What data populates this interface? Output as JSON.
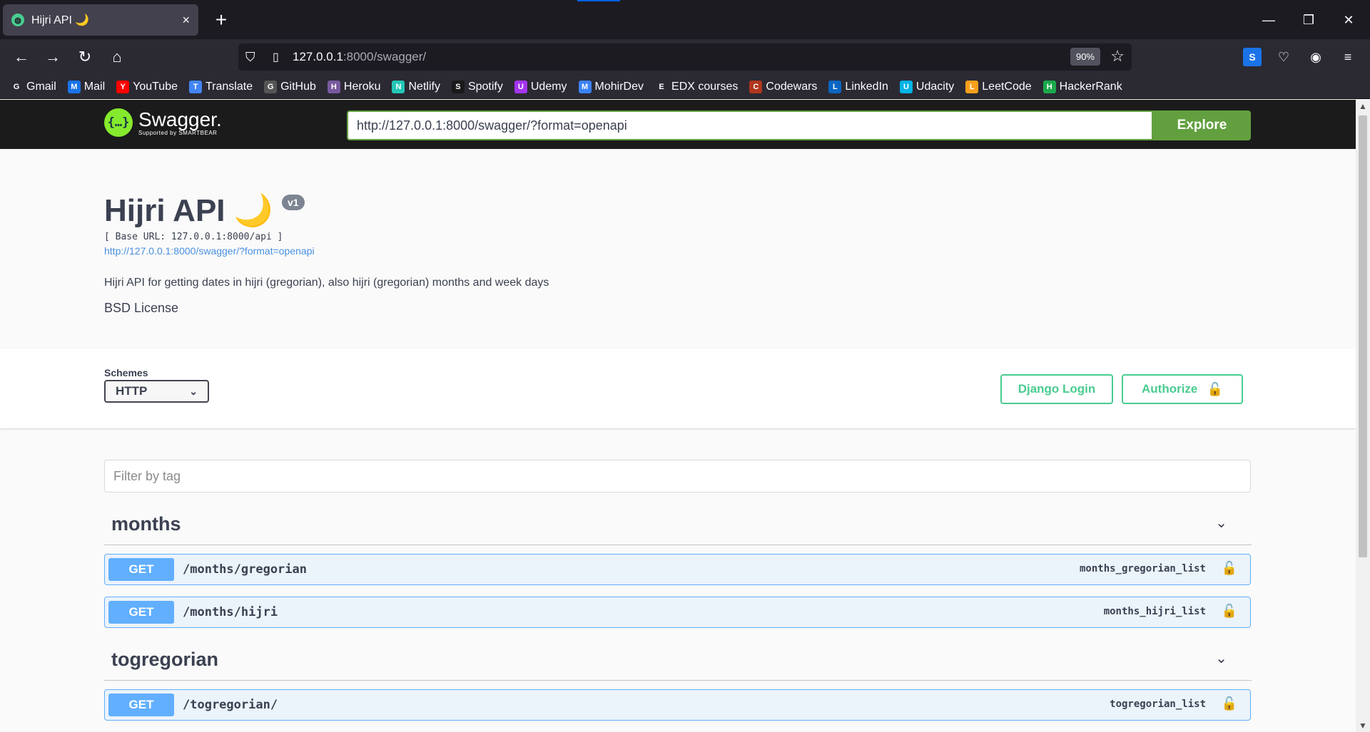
{
  "browser": {
    "tab_title": "Hijri API 🌙",
    "tab_close": "×",
    "new_tab": "+",
    "url_host": "127.0.0.1",
    "url_rest": ":8000/swagger/",
    "zoom": "90%",
    "window_controls": [
      "—",
      "❐",
      "✕"
    ],
    "bookmarks": [
      {
        "label": "Gmail",
        "icon": "globe-icon",
        "color": "#2b2a33"
      },
      {
        "label": "Mail",
        "icon": "mail-icon",
        "color": "#1a73e8"
      },
      {
        "label": "YouTube",
        "icon": "youtube-icon",
        "color": "#ff0000"
      },
      {
        "label": "Translate",
        "icon": "translate-icon",
        "color": "#4285f4"
      },
      {
        "label": "GitHub",
        "icon": "github-icon",
        "color": "#555555"
      },
      {
        "label": "Heroku",
        "icon": "heroku-icon",
        "color": "#79589f"
      },
      {
        "label": "Netlify",
        "icon": "netlify-icon",
        "color": "#25c7b7"
      },
      {
        "label": "Spotify",
        "icon": "spotify-icon",
        "color": "#1a1a1a"
      },
      {
        "label": "Udemy",
        "icon": "udemy-icon",
        "color": "#a435f0"
      },
      {
        "label": "MohirDev",
        "icon": "mohirdev-icon",
        "color": "#3b82f6"
      },
      {
        "label": "EDX courses",
        "icon": "edx-icon",
        "color": "#2b2a33"
      },
      {
        "label": "Codewars",
        "icon": "codewars-icon",
        "color": "#b1361e"
      },
      {
        "label": "LinkedIn",
        "icon": "linkedin-icon",
        "color": "#0a66c2"
      },
      {
        "label": "Udacity",
        "icon": "udacity-icon",
        "color": "#02b3e4"
      },
      {
        "label": "LeetCode",
        "icon": "leetcode-icon",
        "color": "#f89f1b"
      },
      {
        "label": "HackerRank",
        "icon": "hackerrank-icon",
        "color": "#1ba94c"
      }
    ]
  },
  "swagger": {
    "logo_main": "Swagger.",
    "logo_sub": "Supported by SMARTBEAR",
    "explore_url": "http://127.0.0.1:8000/swagger/?format=openapi",
    "explore_label": "Explore"
  },
  "info": {
    "title": "Hijri API 🌙",
    "version": "v1",
    "base_url": "[ Base URL: 127.0.0.1:8000/api ]",
    "spec_link": "http://127.0.0.1:8000/swagger/?format=openapi",
    "description": "Hijri API for getting dates in hijri (gregorian), also hijri (gregorian) months and week days",
    "license": "BSD License"
  },
  "schemes": {
    "label": "Schemes",
    "selected": "HTTP",
    "django_login": "Django Login",
    "authorize": "Authorize"
  },
  "filter_placeholder": "Filter by tag",
  "tags": [
    {
      "name": "months",
      "operations": [
        {
          "method": "GET",
          "path": "/months/gregorian",
          "operation_id": "months_gregorian_list"
        },
        {
          "method": "GET",
          "path": "/months/hijri",
          "operation_id": "months_hijri_list"
        }
      ]
    },
    {
      "name": "togregorian",
      "operations": [
        {
          "method": "GET",
          "path": "/togregorian/",
          "operation_id": "togregorian_list"
        }
      ]
    }
  ],
  "colors": {
    "get": "#61affe",
    "explore": "#62a03f",
    "authorize": "#49cc90"
  }
}
